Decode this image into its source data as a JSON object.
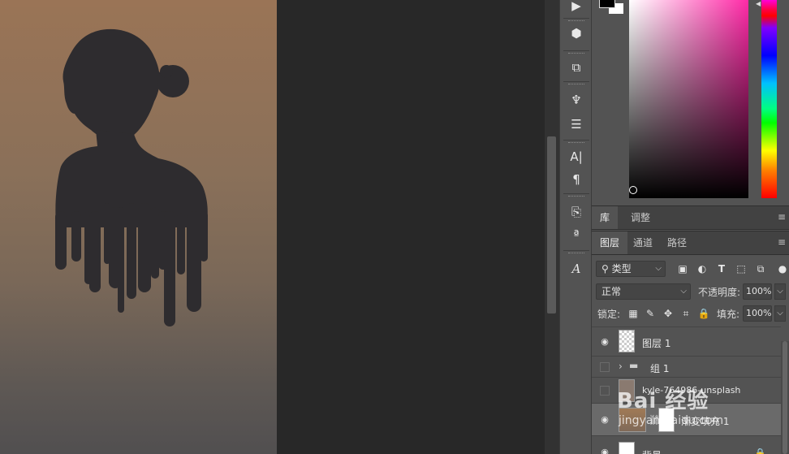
{
  "panels": {
    "library_tabs": [
      "库",
      "调整"
    ],
    "layers_tabs": [
      "图层",
      "通道",
      "路径"
    ]
  },
  "filter": {
    "kind_label": "类型"
  },
  "blend": {
    "mode": "正常",
    "opacity_label": "不透明度:",
    "opacity_value": "100%"
  },
  "lock": {
    "label": "锁定:",
    "fill_label": "填充:",
    "fill_value": "100%"
  },
  "layers": [
    {
      "name": "图层 1",
      "visible": true
    },
    {
      "name": "组 1",
      "visible": false
    },
    {
      "name": "kyle-764986-unsplash",
      "visible": false
    },
    {
      "name": "渐变填充 1",
      "visible": true
    },
    {
      "name": "背景",
      "visible": true
    }
  ],
  "tools": [
    "play-icon",
    "3d-cube-icon",
    "transform-icon",
    "brush-preset-icon",
    "adjust-sliders-icon",
    "character-icon",
    "paragraph-icon",
    "clone-source-icon",
    "glyph-icon",
    "type-style-icon"
  ],
  "watermark": {
    "text": "Bai 经验",
    "sub": "jingyan.baidu.com"
  },
  "colors": {
    "canvas_top": "#9a7456",
    "canvas_bottom": "#514f50",
    "ui_panel": "#535353",
    "ui_dark": "#282828"
  }
}
